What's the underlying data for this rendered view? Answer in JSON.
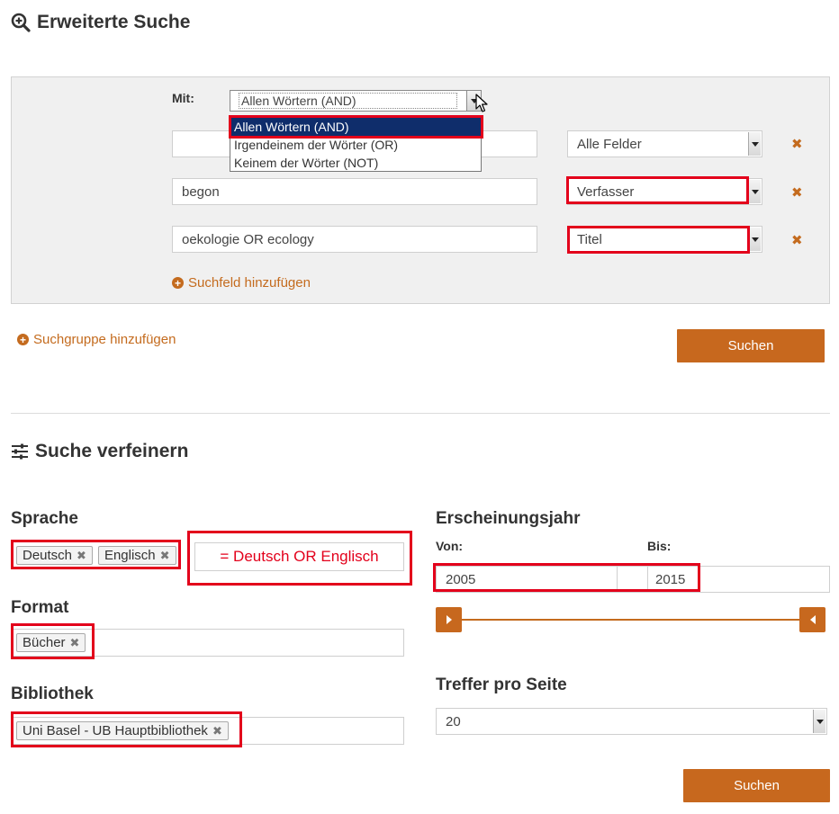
{
  "header": {
    "title": "Erweiterte Suche",
    "icon": "zoom-plus-icon"
  },
  "search_group": {
    "match_label": "Mit:",
    "match_selected": "Allen Wörtern (AND)",
    "match_options": [
      "Allen Wörtern (AND)",
      "Irgendeinem der Wörter (OR)",
      "Keinem der Wörter (NOT)"
    ],
    "rows": [
      {
        "value": "",
        "field": "Alle Felder"
      },
      {
        "value": "begon",
        "field": "Verfasser"
      },
      {
        "value": "oekologie OR ecology",
        "field": "Titel"
      }
    ],
    "remove_symbol": "✖",
    "add_field": "Suchfeld hinzufügen"
  },
  "add_group": "Suchgruppe hinzufügen",
  "search_button": "Suchen",
  "refine": {
    "title": "Suche verfeinern",
    "icon": "sliders-icon",
    "language": {
      "label": "Sprache",
      "chips": [
        "Deutsch",
        "Englisch"
      ],
      "note": "= Deutsch OR Englisch"
    },
    "format": {
      "label": "Format",
      "chips": [
        "Bücher"
      ]
    },
    "library": {
      "label": "Bibliothek",
      "chips": [
        "Uni Basel - UB Hauptbibliothek"
      ]
    },
    "year": {
      "label": "Erscheinungsjahr",
      "from_label": "Von:",
      "to_label": "Bis:",
      "from": "2005",
      "to": "2015"
    },
    "per_page": {
      "label": "Treffer pro Seite",
      "value": "20"
    },
    "chip_remove": "✖",
    "search_button": "Suchen"
  },
  "colors": {
    "accent": "#c7681e",
    "highlight": "#e3001b",
    "selected_option": "#0f2d6b",
    "panel": "#f0f0f0"
  }
}
